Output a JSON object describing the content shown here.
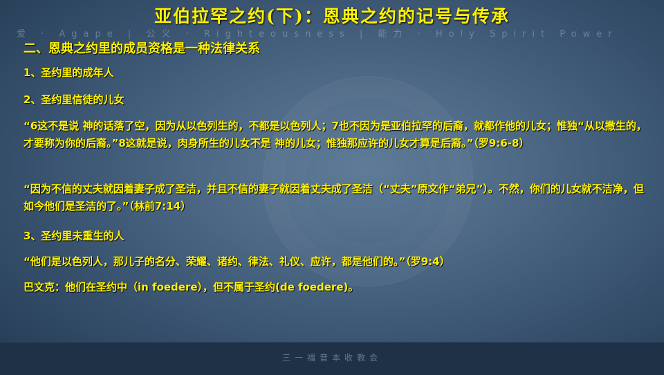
{
  "slide": {
    "title": "亚伯拉罕之约(下)：恩典之约的记号与传承",
    "banner": "爱 · Agape  |  公义 · Righteousness  |  能力 · Holy Spirit Power",
    "heading": "二、恩典之约里的成员资格是一种法律关系",
    "item1": "1、圣约里的成年人",
    "item2": "2、圣约里信徒的儿女",
    "quote1": "“6这不是说  神的话落了空，因为从以色列生的，不都是以色列人；7也不因为是亚伯拉罕的后裔，就都作他的儿女；惟独“从以撒生的，才要称为你的后裔。”8这就是说，肉身所生的儿女不是  神的儿女；惟独那应许的儿女才算是后裔。”（罗9:6-8）",
    "quote2": "“因为不信的丈夫就因着妻子成了圣洁，并且不信的妻子就因着丈夫成了圣洁（“丈夫”原文作“弟兄”）。不然，你们的儿女就不洁净，但如今他们是圣洁的了。”（林前7:14）",
    "item3": "3、圣约里未重生的人",
    "quote3": "“他们是以色列人，那儿子的名分、荣耀、诸约、律法、礼仪、应许，都是他们的。”（罗9:4）",
    "note": "巴文克：他们在圣约中（in foedere），但不属于圣约(de foedere)。",
    "footer": "三一福音本收教会"
  },
  "colors": {
    "text": "#fff200",
    "background": "#4a6683"
  }
}
